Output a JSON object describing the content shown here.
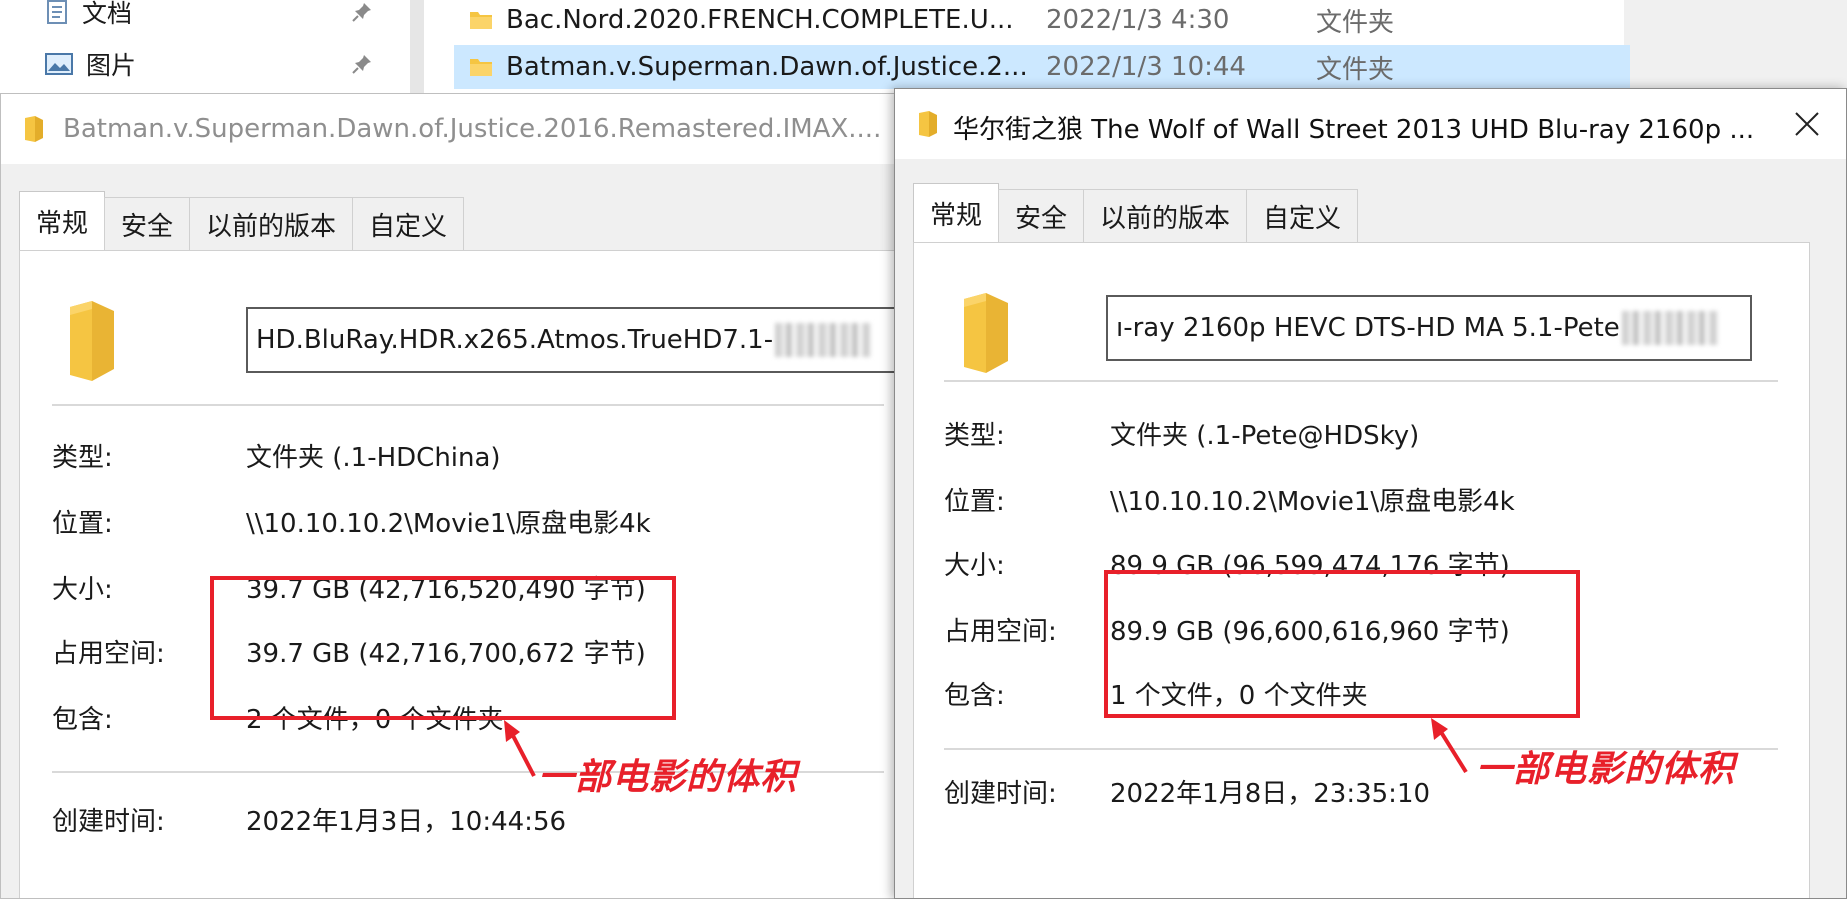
{
  "explorer": {
    "nav_items": [
      {
        "label": "文档",
        "icon": "documents-icon"
      },
      {
        "label": "图片",
        "icon": "pictures-icon"
      }
    ],
    "files": [
      {
        "name": "Bac.Nord.2020.FRENCH.COMPLETE.U...",
        "date": "2022/1/3 4:30",
        "type": "文件夹"
      },
      {
        "name": "Batman.v.Superman.Dawn.of.Justice.2...",
        "date": "2022/1/3 10:44",
        "type": "文件夹"
      }
    ]
  },
  "dialog_left": {
    "title": "Batman.v.Superman.Dawn.of.Justice.2016.Remastered.IMAX....",
    "tabs": [
      "常规",
      "安全",
      "以前的版本",
      "自定义"
    ],
    "name_value": "HD.BluRay.HDR.x265.Atmos.TrueHD7.1-",
    "props": [
      {
        "label": "类型:",
        "value": "文件夹 (.1-HDChina)"
      },
      {
        "label": "位置:",
        "value": "\\\\10.10.10.2\\Movie1\\原盘电影4k"
      },
      {
        "label": "大小:",
        "value": "39.7 GB (42,716,520,490 字节)"
      },
      {
        "label": "占用空间:",
        "value": "39.7 GB (42,716,700,672 字节)"
      },
      {
        "label": "包含:",
        "value": "2 个文件，0 个文件夹"
      },
      {
        "label": "创建时间:",
        "value": "2022年1月3日，10:44:56"
      }
    ],
    "annotation": "一部电影的体积"
  },
  "dialog_right": {
    "title": "华尔街之狼 The Wolf of Wall Street 2013 UHD Blu-ray 2160p ...",
    "tabs": [
      "常规",
      "安全",
      "以前的版本",
      "自定义"
    ],
    "name_value": "ı-ray 2160p HEVC DTS-HD MA 5.1-Pete",
    "props": [
      {
        "label": "类型:",
        "value": "文件夹 (.1-Pete@HDSky)"
      },
      {
        "label": "位置:",
        "value": "\\\\10.10.10.2\\Movie1\\原盘电影4k"
      },
      {
        "label": "大小:",
        "value": "89.9 GB (96,599,474,176 字节)"
      },
      {
        "label": "占用空间:",
        "value": "89.9 GB (96,600,616,960 字节)"
      },
      {
        "label": "包含:",
        "value": "1 个文件，0 个文件夹"
      },
      {
        "label": "创建时间:",
        "value": "2022年1月8日，23:35:10"
      }
    ],
    "annotation": "一部电影的体积"
  },
  "colors": {
    "accent_red": "#e8202a",
    "folder_yellow": "#f5c542",
    "selection": "#cce8ff"
  }
}
